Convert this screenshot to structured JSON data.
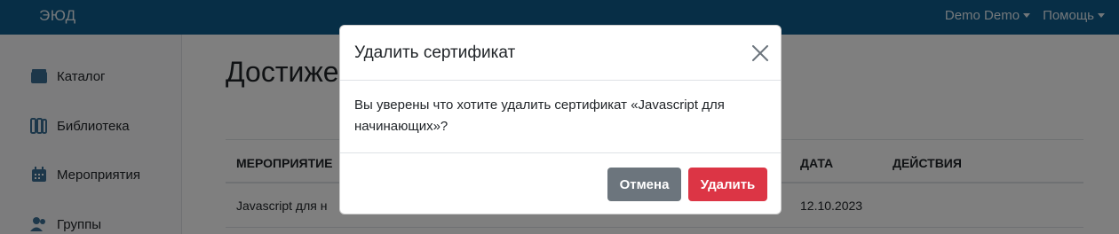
{
  "navbar": {
    "logo": "ЭЮД",
    "user_menu": "Demo Demo",
    "help_menu": "Помощь"
  },
  "sidebar": {
    "items": [
      {
        "label": "Каталог",
        "icon": "catalog-icon"
      },
      {
        "label": "Библиотека",
        "icon": "library-icon"
      },
      {
        "label": "Мероприятия",
        "icon": "calendar-icon"
      },
      {
        "label": "Группы",
        "icon": "users-icon"
      }
    ]
  },
  "main": {
    "title": "Достиже",
    "table": {
      "headers": [
        "МЕРОПРИЯТИЕ",
        "ДАТА",
        "ДЕЙСТВИЯ"
      ],
      "rows": [
        {
          "event": "Javascript для н",
          "date": "12.10.2023"
        }
      ]
    }
  },
  "modal": {
    "title": "Удалить сертификат",
    "body": "Вы уверены что хотите удалить сертификат «Javascript для начинающих»?",
    "cancel_label": "Отмена",
    "delete_label": "Удалить"
  },
  "colors": {
    "navbar": "#0e5d8c",
    "cancel": "#6c757d",
    "delete": "#dc3545"
  }
}
